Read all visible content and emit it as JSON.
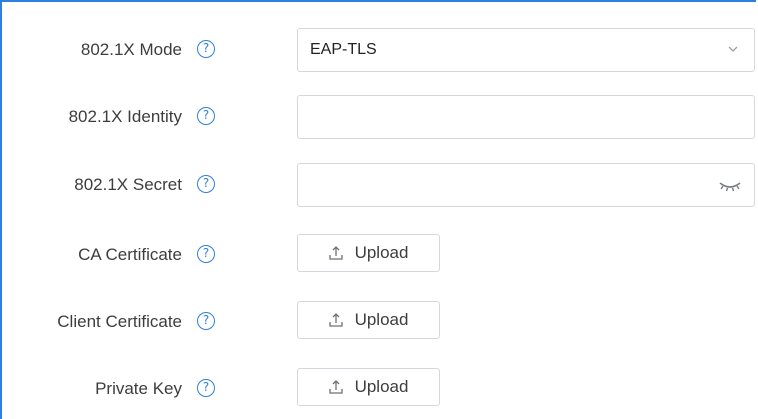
{
  "form": {
    "mode": {
      "label": "802.1X Mode",
      "help_icon": "question-circle-icon",
      "value": "EAP-TLS",
      "dropdown_icon": "chevron-down-icon"
    },
    "identity": {
      "label": "802.1X Identity",
      "help_icon": "question-circle-icon",
      "value": "",
      "placeholder": ""
    },
    "secret": {
      "label": "802.1X Secret",
      "help_icon": "question-circle-icon",
      "value": "",
      "placeholder": "",
      "visibility_icon": "eye-closed-icon"
    },
    "ca_certificate": {
      "label": "CA Certificate",
      "help_icon": "question-circle-icon",
      "button_label": "Upload",
      "button_icon": "upload-icon"
    },
    "client_certificate": {
      "label": "Client Certificate",
      "help_icon": "question-circle-icon",
      "button_label": "Upload",
      "button_icon": "upload-icon"
    },
    "private_key": {
      "label": "Private Key",
      "help_icon": "question-circle-icon",
      "button_label": "Upload",
      "button_icon": "upload-icon"
    }
  },
  "colors": {
    "accent": "#2f7fe0",
    "border": "#d4d7dc",
    "text": "#3d3d3d"
  }
}
